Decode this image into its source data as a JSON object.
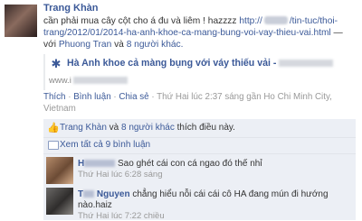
{
  "post": {
    "author": "Trang Khàn",
    "text_line1": "cần phải mua cây cột cho á đu và liêm ! hazzzz",
    "url_part1": "http://",
    "url_part2": "/tin-tuc/thoi-trang/2012/01/2014-ha-anh-khoe-ca-mang-bung-voi-vay-thieu-vai.html",
    "with_prefix": "— với",
    "tagged_person": "Phuong Tran",
    "and_text": "và",
    "others_link": "8 người khác."
  },
  "shared_link": {
    "title": "Hà Anh khoe cả màng bụng với váy thiếu vải -",
    "host_prefix": "www.i"
  },
  "actions": {
    "like": "Thích",
    "comment": "Bình luận",
    "share": "Chia sẻ",
    "sep": "·",
    "timestamp": "Thứ Hai lúc 2:37 sáng gần Ho Chi Minh City, Vietnam"
  },
  "likes": {
    "person": "Trang Khàn",
    "and_text": "và",
    "others": "8 người khác",
    "suffix": "thích điều này."
  },
  "view_comments": "Xem tất cả 9 bình luận",
  "comments": [
    {
      "name_prefix": "H",
      "text": "Sao ghét cái con cá ngao đó thế nhỉ",
      "meta": "Thứ Hai lúc 6:28 sáng"
    },
    {
      "name_prefix": "T",
      "name_suffix": "Nguyen",
      "text": "chẳng hiểu nỗi cái cái cô HA đang mún đi hướng nào.haiz",
      "meta": "Thứ Hai lúc 7:22 chiều"
    }
  ]
}
